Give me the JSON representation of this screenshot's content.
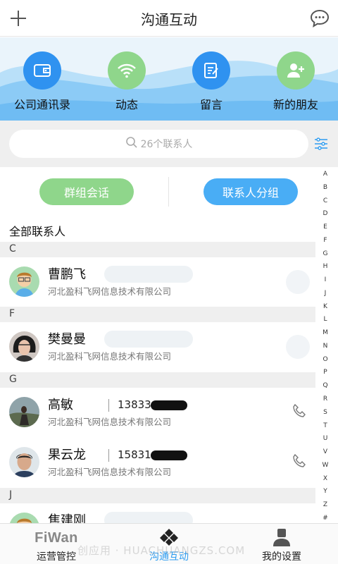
{
  "header": {
    "title": "沟通互动",
    "add_icon": "plus-icon",
    "chat_icon": "chat-bubble-icon"
  },
  "quick_actions": [
    {
      "label": "公司通讯录",
      "icon": "wallet-icon",
      "color": "#2f92f0"
    },
    {
      "label": "动态",
      "icon": "wifi-icon",
      "color": "#8fd68b"
    },
    {
      "label": "留言",
      "icon": "note-edit-icon",
      "color": "#2f92f0"
    },
    {
      "label": "新的朋友",
      "icon": "add-person-icon",
      "color": "#8fd68b"
    }
  ],
  "search": {
    "placeholder": "26个联系人"
  },
  "buttons": {
    "group_chat": "群组会话",
    "contact_groups": "联系人分组"
  },
  "all_contacts_label": "全部联系人",
  "sections": [
    {
      "letter": "C"
    },
    {
      "letter": "F"
    },
    {
      "letter": "G"
    },
    {
      "letter": "J"
    }
  ],
  "contacts": [
    {
      "name": "曹鹏飞",
      "company": "河北盈科飞网信息技术有限公司",
      "phone": ""
    },
    {
      "name": "樊曼曼",
      "company": "河北盈科飞网信息技术有限公司",
      "phone": ""
    },
    {
      "name": "高敏",
      "company": "河北盈科飞网信息技术有限公司",
      "phone": "13833"
    },
    {
      "name": "果云龙",
      "company": "河北盈科飞网信息技术有限公司",
      "phone": "15831"
    },
    {
      "name": "焦建刚",
      "company": "",
      "phone": ""
    }
  ],
  "alphabet": [
    "A",
    "B",
    "C",
    "D",
    "E",
    "F",
    "G",
    "H",
    "I",
    "J",
    "K",
    "L",
    "M",
    "N",
    "O",
    "P",
    "Q",
    "R",
    "S",
    "T",
    "U",
    "V",
    "W",
    "X",
    "Y",
    "Z",
    "#"
  ],
  "bottom_nav": [
    {
      "label": "运营管控",
      "logo": "FiWan"
    },
    {
      "label": "沟通互动"
    },
    {
      "label": "我的设置"
    }
  ],
  "colors": {
    "accent": "#2d9cf0",
    "green": "#8fd68b",
    "blue": "#49adf5"
  },
  "watermark": "创应用 · HUACHUANGZS.COM"
}
